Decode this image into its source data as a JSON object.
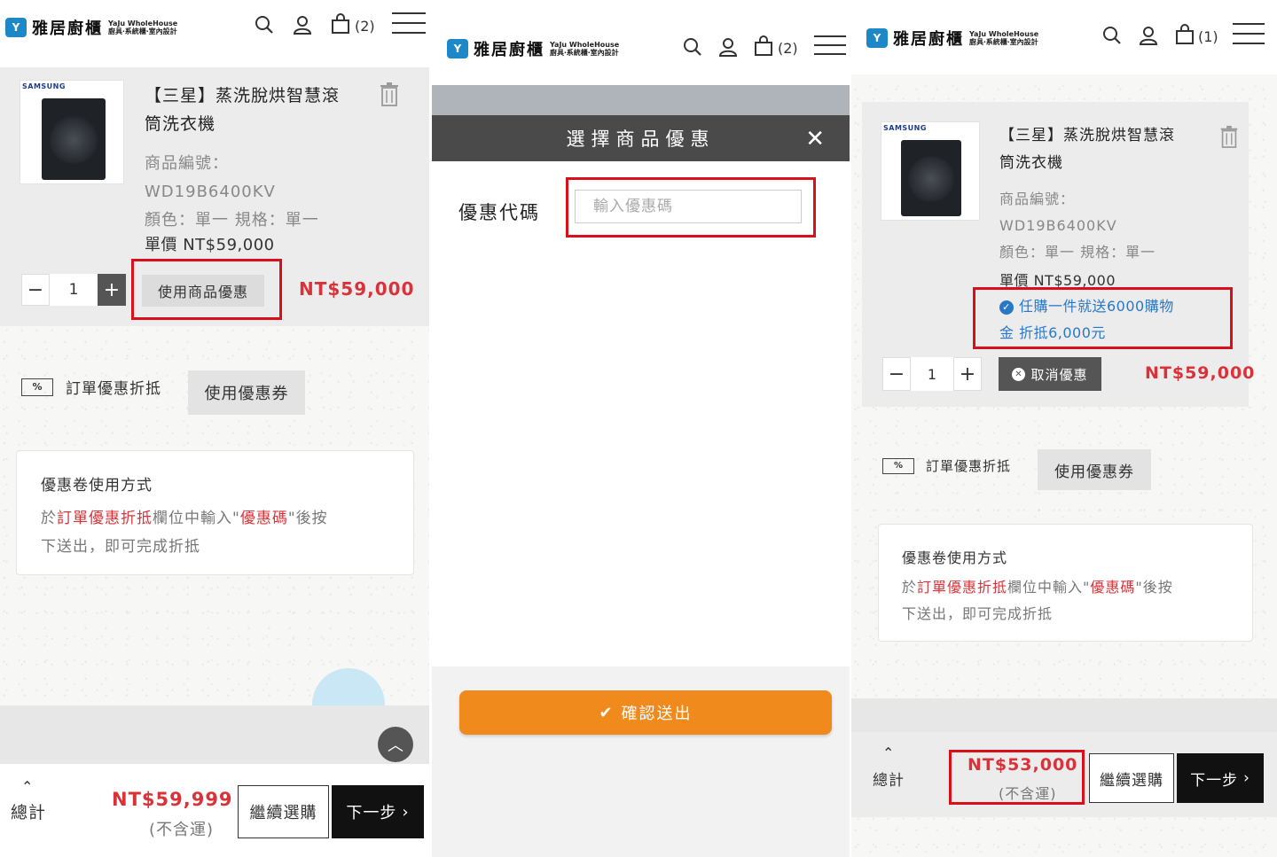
{
  "brand": {
    "name": "雅居廚櫃",
    "mark": "Y",
    "sub_line1": "YaJu WholeHouse",
    "sub_line2": "廚具‧系統櫃‧室內設計"
  },
  "header": {
    "cart_count_p1": "(2)",
    "cart_count_p2": "(2)",
    "cart_count_p3": "(1)"
  },
  "product": {
    "brand_label": "SAMSUNG",
    "title_line1": "【三星】蒸洗脫烘智慧滾",
    "title_line2": "筒洗衣機",
    "sku_label": "商品編號：",
    "sku": "WD19B6400KV",
    "variant": "顏色：單一  規格：單一",
    "unit_price": "單價 NT$59,000",
    "quantity": "1",
    "line_total": "NT$59,000"
  },
  "actions": {
    "use_product_promo": "使用商品優惠",
    "cancel_promo": "取消優惠",
    "order_discount_label": "訂單優惠折抵",
    "use_coupon": "使用優惠券",
    "pct_icon": "%"
  },
  "coupon_help": {
    "title": "優惠卷使用方式",
    "line1_pre": "於",
    "line1_hl1": "訂單優惠折抵",
    "line1_mid": "欄位中輸入\"",
    "line1_hl2": "優惠碼",
    "line1_post": "\"後按",
    "line2": "下送出，即可完成折抵"
  },
  "modal": {
    "title": "選擇商品優惠",
    "close": "✕",
    "code_label": "優惠代碼",
    "code_placeholder": "輸入優惠碼",
    "confirm": "確認送出"
  },
  "promo_applied": {
    "line1": "任購一件就送6000購物",
    "line2": "金 折抵6,000元"
  },
  "footer": {
    "total_label": "總計",
    "total_p1": "NT$59,999",
    "total_p3": "NT$53,000",
    "shipping_note": "(不含運)",
    "continue_shopping": "繼續選購",
    "next_step": "下一步"
  },
  "colors": {
    "accent_red": "#d8333a",
    "highlight_box": "#d90f1a",
    "confirm_orange": "#f08a1c",
    "promo_blue": "#2878c8",
    "brand_blue": "#1c88c7"
  }
}
